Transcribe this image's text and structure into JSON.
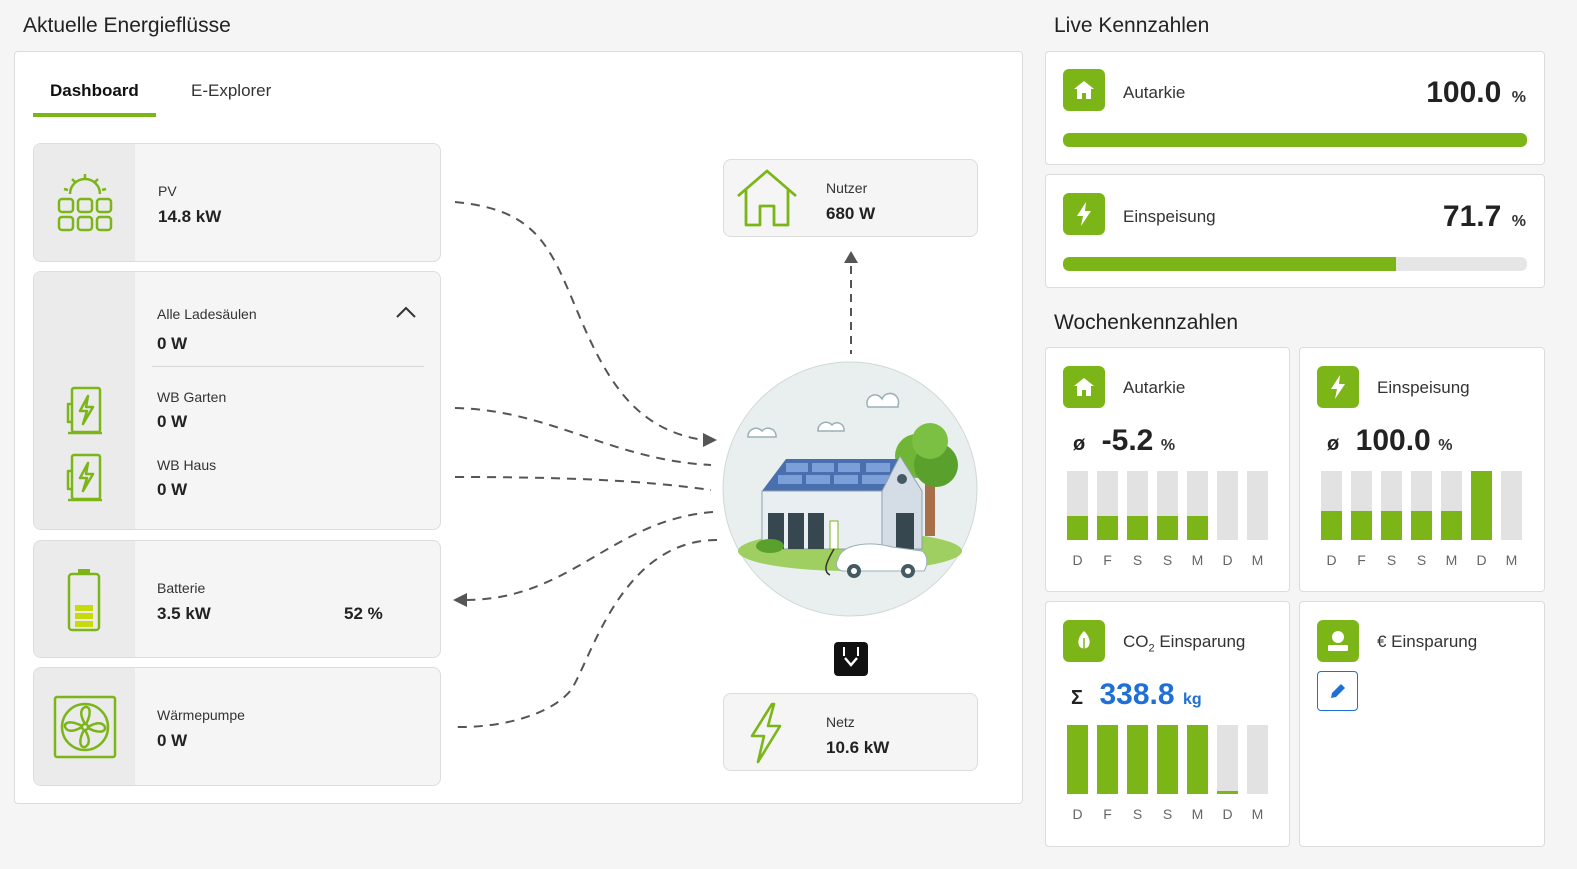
{
  "left": {
    "title": "Aktuelle Energieflüsse",
    "tabs": [
      {
        "label": "Dashboard"
      },
      {
        "label": "E-Explorer"
      }
    ],
    "pv": {
      "label": "PV",
      "value": "14.8 kW"
    },
    "chargers": {
      "label": "Alle Ladesäulen",
      "value": "0 W",
      "items": [
        {
          "label": "WB Garten",
          "value": "0 W"
        },
        {
          "label": "WB Haus",
          "value": "0 W"
        }
      ]
    },
    "battery": {
      "label": "Batterie",
      "value": "3.5 kW",
      "soc": "52 %",
      "soc_fraction": 0.52
    },
    "heatpump": {
      "label": "Wärmepumpe",
      "value": "0 W"
    },
    "user": {
      "label": "Nutzer",
      "value": "680 W"
    },
    "grid": {
      "label": "Netz",
      "value": "10.6 kW"
    }
  },
  "live": {
    "title": "Live Kennzahlen",
    "autarky": {
      "label": "Autarkie",
      "value": "100.0",
      "unit": "%",
      "fraction": 1.0
    },
    "feedin": {
      "label": "Einspeisung",
      "value": "71.7",
      "unit": "%",
      "fraction": 0.717
    }
  },
  "weekly": {
    "title": "Wochenkennzahlen",
    "days": [
      "D",
      "F",
      "S",
      "S",
      "M",
      "D",
      "M"
    ],
    "autarky": {
      "label": "Autarkie",
      "prefix": "ø",
      "value": "-5.2",
      "unit": "%",
      "fills": [
        0.35,
        0.35,
        0.35,
        0.35,
        0.35,
        0,
        0
      ]
    },
    "feedin": {
      "label": "Einspeisung",
      "prefix": "ø",
      "value": "100.0",
      "unit": "%",
      "fills": [
        0.42,
        0.42,
        0.42,
        0.42,
        0.42,
        1.0,
        0
      ]
    },
    "co2": {
      "label_main": "CO",
      "label_sub": "2",
      "label_rest": " Einsparung",
      "prefix": "Σ",
      "value": "338.8",
      "unit": "kg",
      "fills": [
        1.0,
        1.0,
        1.0,
        1.0,
        1.0,
        0.04,
        0
      ]
    },
    "euro": {
      "label": "€ Einsparung"
    }
  },
  "colors": {
    "accent": "#7cb518",
    "value_blue": "#1e6fd6"
  }
}
